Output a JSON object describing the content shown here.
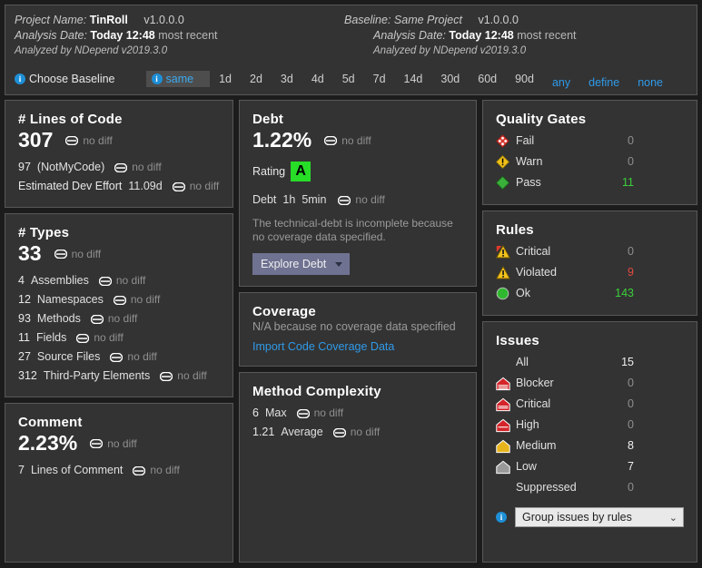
{
  "header": {
    "left": {
      "project_label": "Project Name:",
      "project_name": "TinRoll",
      "version": "v1.0.0.0",
      "analysis_label": "Analysis Date:",
      "analysis_date": "Today 12:48",
      "analysis_suffix": "most recent",
      "analyzed_by": "Analyzed by NDepend v2019.3.0"
    },
    "right": {
      "baseline_label": "Baseline:",
      "baseline_name": "Same Project",
      "version": "v1.0.0.0",
      "analysis_label": "Analysis Date:",
      "analysis_date": "Today 12:48",
      "analysis_suffix": "most recent",
      "analyzed_by": "Analyzed by NDepend v2019.3.0"
    },
    "choose_baseline": "Choose Baseline",
    "tabs": [
      {
        "label": "same",
        "selected": true,
        "link": false
      },
      {
        "label": "1d",
        "selected": false,
        "link": false
      },
      {
        "label": "2d",
        "selected": false,
        "link": false
      },
      {
        "label": "3d",
        "selected": false,
        "link": false
      },
      {
        "label": "4d",
        "selected": false,
        "link": false
      },
      {
        "label": "5d",
        "selected": false,
        "link": false
      },
      {
        "label": "7d",
        "selected": false,
        "link": false
      },
      {
        "label": "14d",
        "selected": false,
        "link": false
      },
      {
        "label": "30d",
        "selected": false,
        "link": false
      },
      {
        "label": "60d",
        "selected": false,
        "link": false
      },
      {
        "label": "90d",
        "selected": false,
        "link": false
      },
      {
        "label": "any",
        "selected": false,
        "link": true
      },
      {
        "label": "define",
        "selected": false,
        "link": true
      },
      {
        "label": "none",
        "selected": false,
        "link": true
      }
    ]
  },
  "no_diff_text": "no diff",
  "lines_of_code": {
    "title": "# Lines of Code",
    "value": "307",
    "rows": [
      {
        "num": "97",
        "label": "(NotMyCode)"
      },
      {
        "num": "Estimated Dev Effort",
        "label": "11.09d"
      }
    ]
  },
  "types": {
    "title": "# Types",
    "value": "33",
    "rows": [
      {
        "num": "4",
        "label": "Assemblies"
      },
      {
        "num": "12",
        "label": "Namespaces"
      },
      {
        "num": "93",
        "label": "Methods"
      },
      {
        "num": "11",
        "label": "Fields"
      },
      {
        "num": "27",
        "label": "Source Files"
      },
      {
        "num": "312",
        "label": "Third-Party Elements"
      }
    ]
  },
  "comment": {
    "title": "Comment",
    "value": "2.23%",
    "rows": [
      {
        "num": "7",
        "label": "Lines of Comment"
      }
    ]
  },
  "debt": {
    "title": "Debt",
    "value": "1.22%",
    "rating_label": "Rating",
    "rating": "A",
    "debt_label": "Debt",
    "debt_hours": "1h",
    "debt_minutes": "5min",
    "note": "The technical-debt is incomplete because no coverage data specified.",
    "button": "Explore Debt"
  },
  "coverage": {
    "title": "Coverage",
    "note": "N/A because no coverage data specified",
    "link": "Import Code Coverage Data"
  },
  "method_complexity": {
    "title": "Method Complexity",
    "rows": [
      {
        "num": "6",
        "label": "Max"
      },
      {
        "num": "1.21",
        "label": "Average"
      }
    ]
  },
  "quality_gates": {
    "title": "Quality Gates",
    "rows": [
      {
        "icon": "diamond-fail-icon",
        "label": "Fail",
        "value": "0",
        "tone": "dim"
      },
      {
        "icon": "diamond-warn-icon",
        "label": "Warn",
        "value": "0",
        "tone": "dim"
      },
      {
        "icon": "diamond-pass-icon",
        "label": "Pass",
        "value": "11",
        "tone": "green"
      }
    ]
  },
  "rules": {
    "title": "Rules",
    "rows": [
      {
        "icon": "triangle-critical-icon",
        "label": "Critical",
        "value": "0",
        "tone": "dim"
      },
      {
        "icon": "triangle-violated-icon",
        "label": "Violated",
        "value": "9",
        "tone": "red"
      },
      {
        "icon": "circle-ok-icon",
        "label": "Ok",
        "value": "143",
        "tone": "green"
      }
    ]
  },
  "issues": {
    "title": "Issues",
    "rows": [
      {
        "icon": "none",
        "label": "All",
        "value": "15",
        "tone": "white"
      },
      {
        "icon": "severity-blocker-icon",
        "label": "Blocker",
        "value": "0",
        "tone": "dim"
      },
      {
        "icon": "severity-critical-icon",
        "label": "Critical",
        "value": "0",
        "tone": "dim"
      },
      {
        "icon": "severity-high-icon",
        "label": "High",
        "value": "0",
        "tone": "dim"
      },
      {
        "icon": "severity-medium-icon",
        "label": "Medium",
        "value": "8",
        "tone": "white"
      },
      {
        "icon": "severity-low-icon",
        "label": "Low",
        "value": "7",
        "tone": "white"
      },
      {
        "icon": "none",
        "label": "Suppressed",
        "value": "0",
        "tone": "dim"
      }
    ],
    "group_select": "Group issues by rules"
  },
  "colors": {
    "panel_bg": "#333333",
    "page_bg": "#1c1c1c",
    "border": "#585858",
    "link": "#2f9ae8",
    "green": "#3ad13a",
    "red": "#e04a3f",
    "rating_green": "#27dd27",
    "button": "#6f7291"
  }
}
